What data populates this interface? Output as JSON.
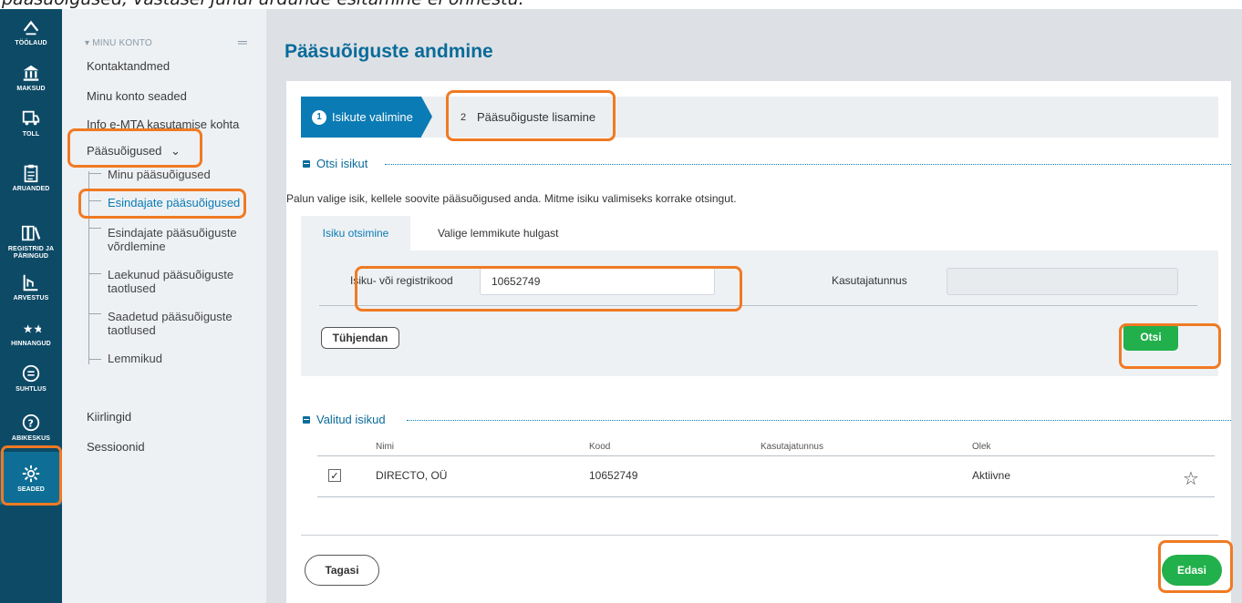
{
  "caption": "pääsuõigused, vastasel juhul urdunde esitamine ei õnnestu.",
  "rail": {
    "items": [
      {
        "label": "TÖÖLAUD",
        "icon": "dashboard-icon"
      },
      {
        "label": "MAKSUD",
        "icon": "bank-icon"
      },
      {
        "label": "TOLL",
        "icon": "truck-icon"
      },
      {
        "label": "ARUANDED",
        "icon": "clipboard-icon"
      },
      {
        "label": "REGISTRID JA PÄRINGUD",
        "icon": "registry-icon"
      },
      {
        "label": "ARVESTUS",
        "icon": "calculator-icon"
      },
      {
        "label": "HINNANGUD",
        "icon": "stars-icon"
      },
      {
        "label": "SUHTLUS",
        "icon": "chat-icon"
      },
      {
        "label": "ABIKESKUS",
        "icon": "help-icon"
      },
      {
        "label": "SEADED",
        "icon": "gear-icon"
      }
    ]
  },
  "subnav": {
    "section_head": "MINU KONTO",
    "menu_toggle": "═",
    "items": {
      "kontakt": "Kontaktandmed",
      "seaded": "Minu konto seaded",
      "info": "Info e-MTA kasutamise kohta",
      "paasuoigused": "Pääsuõigused",
      "paasuoigused_caret": "⌄",
      "kiirlingid": "Kiirlingid",
      "sessioonid": "Sessioonid"
    },
    "subitems": {
      "minu": "Minu pääsuõigused",
      "esindajate": "Esindajate pääsuõigused",
      "vordlemine": "Esindajate pääsuõiguste võrdlemine",
      "laekunud": "Laekunud pääsuõiguste taotlused",
      "saadetud": "Saadetud pääsuõiguste taotlused",
      "lemmikud": "Lemmikud"
    }
  },
  "main": {
    "title": "Pääsuõiguste andmine",
    "steps": [
      {
        "num": "1",
        "label": "Isikute valimine"
      },
      {
        "num": "2",
        "label": "Pääsuõiguste lisamine"
      }
    ],
    "search_section": {
      "title": "Otsi isikut",
      "helper": "Palun valige isik, kellele soovite pääsuõigused anda. Mitme isiku valimiseks korrake otsingut.",
      "tabs": [
        "Isiku otsimine",
        "Valige lemmikute hulgast"
      ],
      "code_label": "Isiku- või registrikood",
      "code_value": "10652749",
      "user_label": "Kasutajatunnus",
      "user_value": "",
      "clear_label": "Tühjendan",
      "search_label": "Otsi"
    },
    "selected_section": {
      "title": "Valitud isikud",
      "columns": [
        "Nimi",
        "Kood",
        "Kasutajatunnus",
        "Olek"
      ],
      "rows": [
        {
          "checked": "✓",
          "name": "DIRECTO, OÜ",
          "code": "10652749",
          "user": "",
          "status": "Aktiivne",
          "fav": "☆"
        }
      ]
    },
    "back_label": "Tagasi",
    "next_label": "Edasi"
  }
}
